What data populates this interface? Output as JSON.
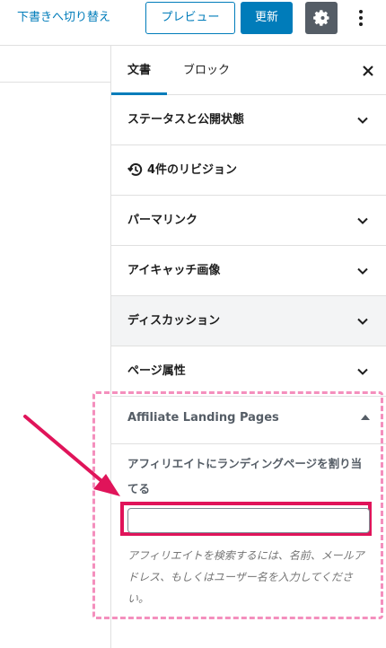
{
  "toolbar": {
    "switch_to_draft": "下書きへ切り替え",
    "preview": "プレビュー",
    "update": "更新",
    "settings_icon": "gear-icon",
    "more_icon": "vertical-ellipsis-icon"
  },
  "sidebar": {
    "tabs": [
      {
        "label": "文書",
        "active": true
      },
      {
        "label": "ブロック",
        "active": false
      }
    ],
    "close_icon": "close-icon",
    "panels": [
      {
        "label": "ステータスと公開状態",
        "icon": "chevron-down-icon"
      },
      {
        "label": "4件のリビジョン",
        "icon": "history-icon"
      },
      {
        "label": "パーマリンク",
        "icon": "chevron-down-icon"
      },
      {
        "label": "アイキャッチ画像",
        "icon": "chevron-down-icon"
      },
      {
        "label": "ディスカッション",
        "icon": "chevron-down-icon"
      },
      {
        "label": "ページ属性",
        "icon": "chevron-down-icon"
      }
    ],
    "affiliate_panel": {
      "title": "Affiliate Landing Pages",
      "caret_icon": "caret-up-icon",
      "assign_label": "アフィリエイトにランディングページを割り当てる",
      "input_value": "",
      "help_text": "アフィリエイトを検索するには、名前、メールアドレス、もしくはユーザー名を入力してください。"
    }
  },
  "annotation": {
    "highlight_color": "#e0145a",
    "dashed_color": "#f48fbd"
  }
}
